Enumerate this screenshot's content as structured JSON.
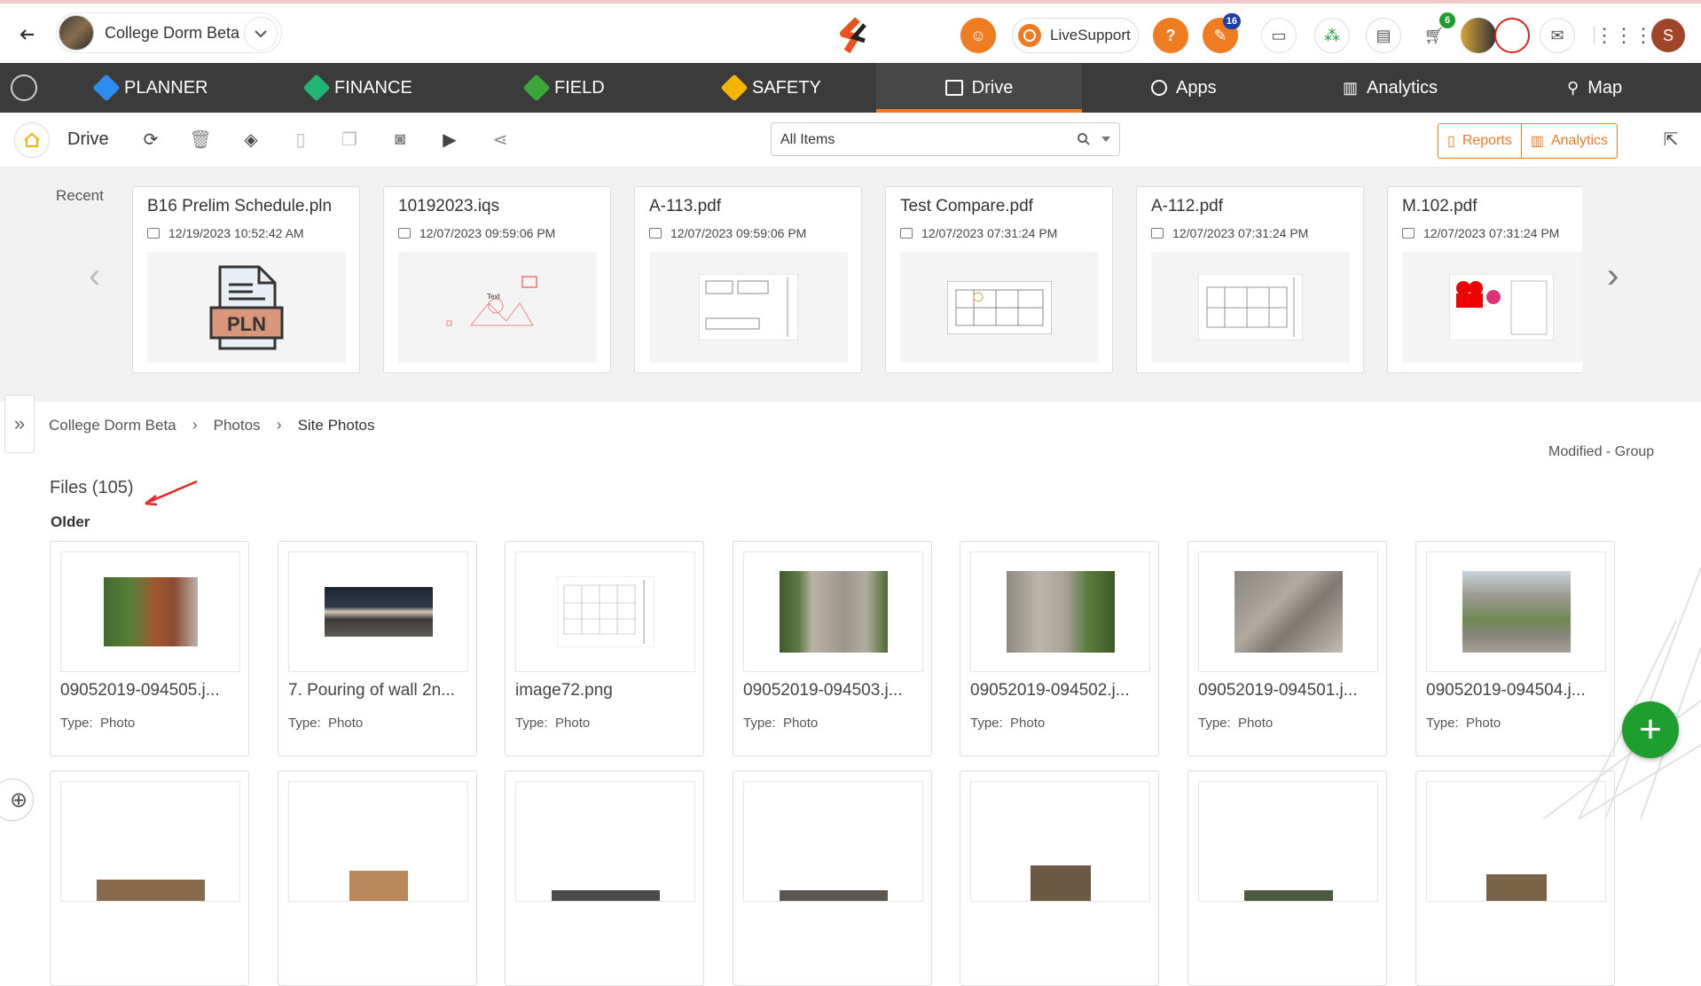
{
  "header": {
    "project_name": "College Dorm Beta",
    "live_support": "LiveSupport",
    "notif_badge": "16",
    "cart_badge": "6",
    "user_initial": "S"
  },
  "nav": {
    "items": [
      {
        "label": "PLANNER",
        "color": "#2d8cf0"
      },
      {
        "label": "FINANCE",
        "color": "#22b573"
      },
      {
        "label": "FIELD",
        "color": "#3aa63a"
      },
      {
        "label": "SAFETY",
        "color": "#f5b400"
      },
      {
        "label": "Drive",
        "color": "#ffffff"
      },
      {
        "label": "Apps",
        "color": "#ffffff"
      },
      {
        "label": "Analytics",
        "color": "#ffffff"
      },
      {
        "label": "Map",
        "color": "#ffffff"
      }
    ],
    "active": "Drive",
    "accent": "#f07c22"
  },
  "toolbar": {
    "title": "Drive",
    "search_value": "All Items",
    "reports": "Reports",
    "analytics": "Analytics"
  },
  "recent": {
    "label": "Recent",
    "items": [
      {
        "name": "B16 Prelim Schedule.pln",
        "date": "12/19/2023 10:52:42 AM"
      },
      {
        "name": "10192023.iqs",
        "date": "12/07/2023 09:59:06 PM"
      },
      {
        "name": "A-113.pdf",
        "date": "12/07/2023 09:59:06 PM"
      },
      {
        "name": "Test Compare.pdf",
        "date": "12/07/2023 07:31:24 PM"
      },
      {
        "name": "A-112.pdf",
        "date": "12/07/2023 07:31:24 PM"
      },
      {
        "name": "M.102.pdf",
        "date": "12/07/2023 07:31:24 PM"
      }
    ],
    "pln_label": "PLN",
    "text_label": "Text"
  },
  "breadcrumb": [
    "College Dorm Beta",
    "Photos",
    "Site Photos"
  ],
  "sort_label": "Modified - Group",
  "files_title": "Files (105)",
  "group_label": "Older",
  "type_label": "Type:",
  "files": [
    {
      "name": "09052019-094505.j...",
      "type": "Photo"
    },
    {
      "name": "7. Pouring of wall 2n...",
      "type": "Photo"
    },
    {
      "name": "image72.png",
      "type": "Photo"
    },
    {
      "name": "09052019-094503.j...",
      "type": "Photo"
    },
    {
      "name": "09052019-094502.j...",
      "type": "Photo"
    },
    {
      "name": "09052019-094501.j...",
      "type": "Photo"
    },
    {
      "name": "09052019-094504.j...",
      "type": "Photo"
    }
  ]
}
